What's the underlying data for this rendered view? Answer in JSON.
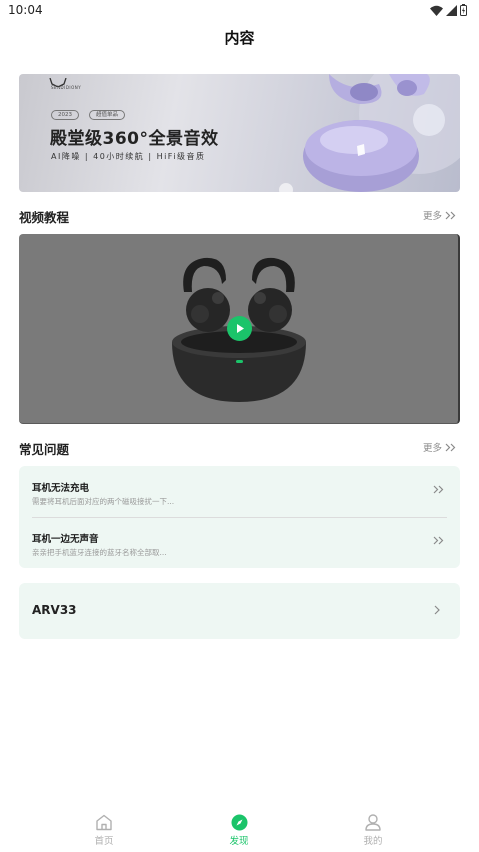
{
  "status_bar": {
    "time": "10:04"
  },
  "header": {
    "title": "内容"
  },
  "banner": {
    "brand": "SENDIDIONY",
    "pill_year": "2023",
    "pill_tag": "超值单品",
    "headline": "殿堂级360°全景音效",
    "subline": "AI降噪  |  40小时续航  |  HiFi级音质"
  },
  "video_section": {
    "title": "视频教程",
    "more": "更多"
  },
  "faq_section": {
    "title": "常见问题",
    "more": "更多",
    "items": [
      {
        "title": "耳机无法充电",
        "desc": "需要将耳机后面对应的两个磁吸接扰一下..."
      },
      {
        "title": "耳机一边无声音",
        "desc": "亲亲把手机蓝牙连接的蓝牙名称全部取..."
      }
    ]
  },
  "device": {
    "name": "ARV33"
  },
  "tabs": [
    {
      "label": "首页",
      "icon": "home-icon",
      "active": false
    },
    {
      "label": "发现",
      "icon": "compass-icon",
      "active": true
    },
    {
      "label": "我的",
      "icon": "person-icon",
      "active": false
    }
  ],
  "colors": {
    "accent": "#1bc46a",
    "card_bg": "#eef7f3",
    "inactive": "#b0b0b0"
  }
}
